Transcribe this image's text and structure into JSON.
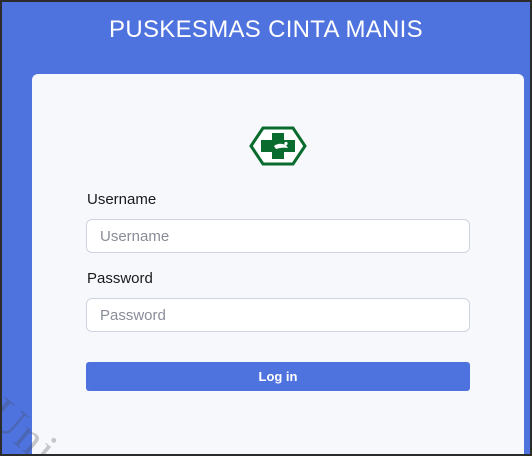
{
  "app": {
    "title": "PUSKESMAS CINTA MANIS"
  },
  "logo": {
    "icon": "health-cross-logo-icon",
    "color": "#0a6b2e"
  },
  "form": {
    "username_label": "Username",
    "username_placeholder": "Username",
    "username_value": "",
    "password_label": "Password",
    "password_placeholder": "Password",
    "password_value": "",
    "login_label": "Log in"
  },
  "watermark": {
    "text": "Uni"
  },
  "colors": {
    "primary": "#4e73df",
    "card": "#f7f8fc",
    "logo_green": "#0a6b2e"
  }
}
